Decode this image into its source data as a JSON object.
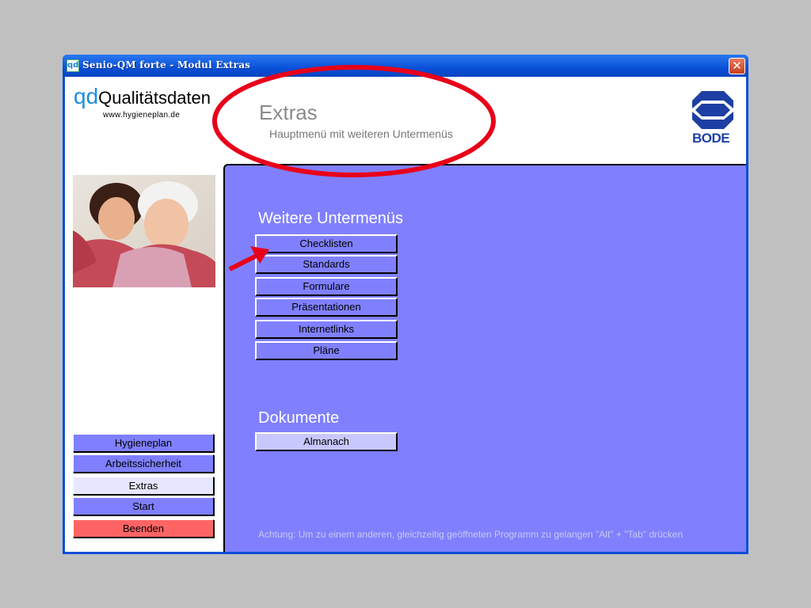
{
  "window": {
    "title": "Senio-QM forte - Modul Extras",
    "app_icon_text": "qd",
    "close_glyph": "✕"
  },
  "logo": {
    "prefix": "qd",
    "word": "Qualitätsdaten",
    "url": "www.hygieneplan.de"
  },
  "header": {
    "title": "Extras",
    "subtitle": "Hauptmenü mit weiteren Untermenüs"
  },
  "brand": {
    "name": "BODE",
    "color": "#1d3fa3"
  },
  "left_nav": {
    "items": [
      {
        "label": "Hygieneplan"
      },
      {
        "label": "Arbeitssicherheit"
      },
      {
        "label": "Extras"
      },
      {
        "label": "Start"
      },
      {
        "label": "Beenden"
      }
    ]
  },
  "main": {
    "submenus_title": "Weitere Untermenüs",
    "submenus": [
      {
        "label": "Checklisten"
      },
      {
        "label": "Standards"
      },
      {
        "label": "Formulare"
      },
      {
        "label": "Präsentationen"
      },
      {
        "label": "Internetlinks"
      },
      {
        "label": "Pläne"
      }
    ],
    "documents_title": "Dokumente",
    "documents": [
      {
        "label": "Almanach"
      }
    ],
    "hint": "Achtung: Um zu einem anderen, gleichzeitig geöffneten Programm zu gelangen \"Alt\" + \"Tab\" drücken"
  },
  "colors": {
    "panel": "#8080ff",
    "annotation": "#e8001a",
    "exit_button": "#ff6464"
  }
}
